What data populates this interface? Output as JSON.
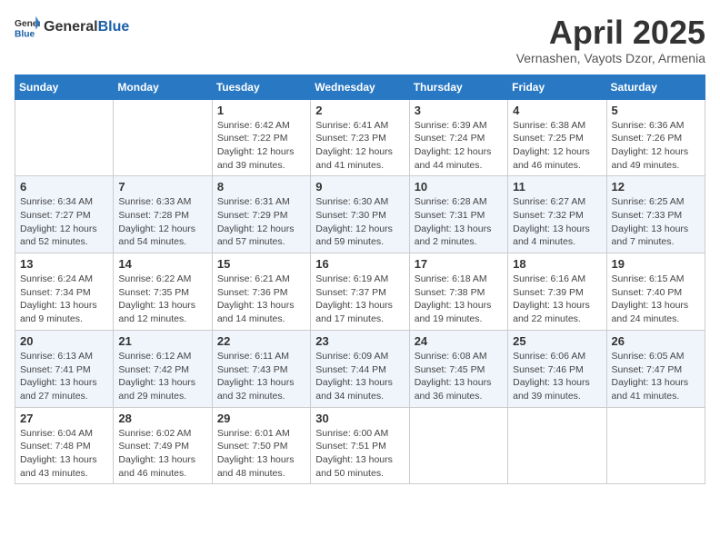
{
  "header": {
    "logo_general": "General",
    "logo_blue": "Blue",
    "month_title": "April 2025",
    "location": "Vernashen, Vayots Dzor, Armenia"
  },
  "weekdays": [
    "Sunday",
    "Monday",
    "Tuesday",
    "Wednesday",
    "Thursday",
    "Friday",
    "Saturday"
  ],
  "weeks": [
    [
      {
        "day": "",
        "info": ""
      },
      {
        "day": "",
        "info": ""
      },
      {
        "day": "1",
        "info": "Sunrise: 6:42 AM\nSunset: 7:22 PM\nDaylight: 12 hours and 39 minutes."
      },
      {
        "day": "2",
        "info": "Sunrise: 6:41 AM\nSunset: 7:23 PM\nDaylight: 12 hours and 41 minutes."
      },
      {
        "day": "3",
        "info": "Sunrise: 6:39 AM\nSunset: 7:24 PM\nDaylight: 12 hours and 44 minutes."
      },
      {
        "day": "4",
        "info": "Sunrise: 6:38 AM\nSunset: 7:25 PM\nDaylight: 12 hours and 46 minutes."
      },
      {
        "day": "5",
        "info": "Sunrise: 6:36 AM\nSunset: 7:26 PM\nDaylight: 12 hours and 49 minutes."
      }
    ],
    [
      {
        "day": "6",
        "info": "Sunrise: 6:34 AM\nSunset: 7:27 PM\nDaylight: 12 hours and 52 minutes."
      },
      {
        "day": "7",
        "info": "Sunrise: 6:33 AM\nSunset: 7:28 PM\nDaylight: 12 hours and 54 minutes."
      },
      {
        "day": "8",
        "info": "Sunrise: 6:31 AM\nSunset: 7:29 PM\nDaylight: 12 hours and 57 minutes."
      },
      {
        "day": "9",
        "info": "Sunrise: 6:30 AM\nSunset: 7:30 PM\nDaylight: 12 hours and 59 minutes."
      },
      {
        "day": "10",
        "info": "Sunrise: 6:28 AM\nSunset: 7:31 PM\nDaylight: 13 hours and 2 minutes."
      },
      {
        "day": "11",
        "info": "Sunrise: 6:27 AM\nSunset: 7:32 PM\nDaylight: 13 hours and 4 minutes."
      },
      {
        "day": "12",
        "info": "Sunrise: 6:25 AM\nSunset: 7:33 PM\nDaylight: 13 hours and 7 minutes."
      }
    ],
    [
      {
        "day": "13",
        "info": "Sunrise: 6:24 AM\nSunset: 7:34 PM\nDaylight: 13 hours and 9 minutes."
      },
      {
        "day": "14",
        "info": "Sunrise: 6:22 AM\nSunset: 7:35 PM\nDaylight: 13 hours and 12 minutes."
      },
      {
        "day": "15",
        "info": "Sunrise: 6:21 AM\nSunset: 7:36 PM\nDaylight: 13 hours and 14 minutes."
      },
      {
        "day": "16",
        "info": "Sunrise: 6:19 AM\nSunset: 7:37 PM\nDaylight: 13 hours and 17 minutes."
      },
      {
        "day": "17",
        "info": "Sunrise: 6:18 AM\nSunset: 7:38 PM\nDaylight: 13 hours and 19 minutes."
      },
      {
        "day": "18",
        "info": "Sunrise: 6:16 AM\nSunset: 7:39 PM\nDaylight: 13 hours and 22 minutes."
      },
      {
        "day": "19",
        "info": "Sunrise: 6:15 AM\nSunset: 7:40 PM\nDaylight: 13 hours and 24 minutes."
      }
    ],
    [
      {
        "day": "20",
        "info": "Sunrise: 6:13 AM\nSunset: 7:41 PM\nDaylight: 13 hours and 27 minutes."
      },
      {
        "day": "21",
        "info": "Sunrise: 6:12 AM\nSunset: 7:42 PM\nDaylight: 13 hours and 29 minutes."
      },
      {
        "day": "22",
        "info": "Sunrise: 6:11 AM\nSunset: 7:43 PM\nDaylight: 13 hours and 32 minutes."
      },
      {
        "day": "23",
        "info": "Sunrise: 6:09 AM\nSunset: 7:44 PM\nDaylight: 13 hours and 34 minutes."
      },
      {
        "day": "24",
        "info": "Sunrise: 6:08 AM\nSunset: 7:45 PM\nDaylight: 13 hours and 36 minutes."
      },
      {
        "day": "25",
        "info": "Sunrise: 6:06 AM\nSunset: 7:46 PM\nDaylight: 13 hours and 39 minutes."
      },
      {
        "day": "26",
        "info": "Sunrise: 6:05 AM\nSunset: 7:47 PM\nDaylight: 13 hours and 41 minutes."
      }
    ],
    [
      {
        "day": "27",
        "info": "Sunrise: 6:04 AM\nSunset: 7:48 PM\nDaylight: 13 hours and 43 minutes."
      },
      {
        "day": "28",
        "info": "Sunrise: 6:02 AM\nSunset: 7:49 PM\nDaylight: 13 hours and 46 minutes."
      },
      {
        "day": "29",
        "info": "Sunrise: 6:01 AM\nSunset: 7:50 PM\nDaylight: 13 hours and 48 minutes."
      },
      {
        "day": "30",
        "info": "Sunrise: 6:00 AM\nSunset: 7:51 PM\nDaylight: 13 hours and 50 minutes."
      },
      {
        "day": "",
        "info": ""
      },
      {
        "day": "",
        "info": ""
      },
      {
        "day": "",
        "info": ""
      }
    ]
  ]
}
